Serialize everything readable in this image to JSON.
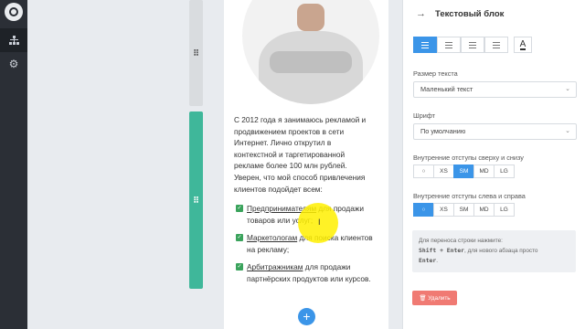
{
  "sidebar": {
    "items": [
      {
        "icon": "sitemap-icon"
      },
      {
        "icon": "gear-icon"
      }
    ]
  },
  "canvas": {
    "paragraph": "С 2012 года я занимаюсь рекламой и продвижением проектов в сети Интернет. Лично открутил в контекстной и таргетированной рекламе более 100 млн рублей. Уверен, что мой способ привлечения клиентов подойдет всем:",
    "bullets": [
      {
        "prefix": "",
        "link": "Предпринимателям",
        "suffix": " для продажи товаров или услуг;"
      },
      {
        "prefix": "",
        "link": "Маркетологам",
        "suffix": " для поиска клиентов на рекламу;"
      },
      {
        "prefix": "",
        "link": "Арбитражникам",
        "suffix": " для продажи партнёрских продуктов или курсов."
      }
    ],
    "add_button": "+"
  },
  "panel": {
    "title": "Текстовый блок",
    "text_size_label": "Размер текста",
    "text_size_value": "Маленький текст",
    "font_label": "Шрифт",
    "font_value": "По умолчанию",
    "vpad_label": "Внутренние отступы сверху и снизу",
    "vpad_options": [
      "○",
      "XS",
      "SM",
      "MD",
      "LG"
    ],
    "vpad_selected": "SM",
    "hpad_label": "Внутренние отступы слева и справа",
    "hpad_options": [
      "○",
      "XS",
      "SM",
      "MD",
      "LG"
    ],
    "hpad_selected": "○",
    "hint_line1": "Для переноса строки нажмите:",
    "hint_key1": "Shift + Enter",
    "hint_mid": ", для нового абзаца просто",
    "hint_key2": "Enter",
    "hint_end": ".",
    "delete_label": "🗑 Удалить"
  },
  "colors": {
    "accent": "#3b95e8",
    "green": "#3fb79a",
    "danger": "#f07a73",
    "rail": "#2b2f36"
  }
}
